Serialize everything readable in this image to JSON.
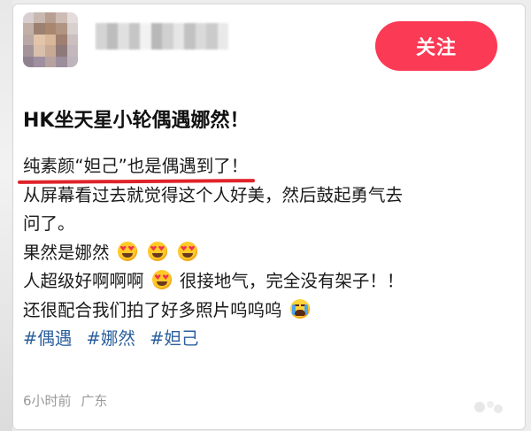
{
  "post": {
    "follow_label": "关注",
    "title": "HK坐天星小轮偶遇娜然！",
    "lines": {
      "l1": "纯素颜“妲己”也是偶遇到了！",
      "l2": "从屏幕看过去就觉得这个人好美，然后鼓起勇气去",
      "l3": "问了。",
      "l4": "果然是娜然",
      "l5a": "人超级好啊啊啊",
      "l5b": "很接地气，完全没有架子！！",
      "l6": "还很配合我们拍了好多照片呜呜呜"
    },
    "tags": [
      "#偶遇",
      "#娜然",
      "#妲己"
    ],
    "time": "6小时前",
    "location": "广东"
  },
  "icons": {
    "heart_eyes": "heart-eyes-emoji",
    "crying": "crying-emoji"
  },
  "colors": {
    "follow_button": "#fb3a55",
    "hashtag": "#2b5f9e",
    "underline": "#e0232a"
  }
}
